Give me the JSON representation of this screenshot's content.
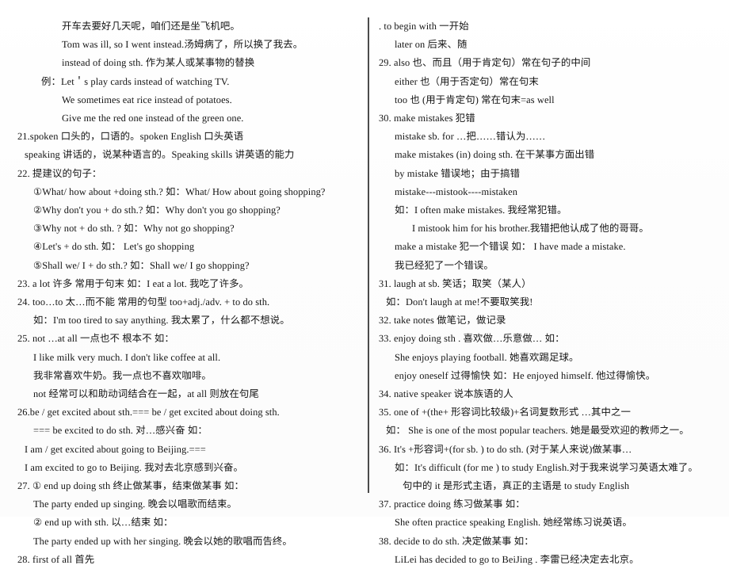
{
  "document": {
    "title": "English Grammar and Phrase Study Notes",
    "page_layout": "two-column",
    "divider": {
      "color": "#2b2b2b",
      "orientation": "vertical"
    }
  },
  "left_column": {
    "lines": [
      {
        "indent": 5,
        "text": "开车去要好几天呢，咱们还是坐飞机吧。"
      },
      {
        "indent": 5,
        "text": "Tom was ill, so I went instead.汤姆病了，所以换了我去。"
      },
      {
        "indent": 5,
        "text": "instead of doing sth.  作为某人或某事物的替换"
      },
      {
        "indent": 3,
        "text": "例：Let＇s play cards instead of watching TV."
      },
      {
        "indent": 5,
        "text": "We sometimes eat rice instead of potatoes."
      },
      {
        "indent": 5,
        "text": "Give me the red one instead of the green one."
      },
      {
        "indent": 0,
        "text": "21.spoken  口头的，口语的。spoken English   口头英语"
      },
      {
        "indent": 1,
        "text": "speaking  讲话的，说某种语言的。Speaking skills 讲英语的能力"
      },
      {
        "indent": 0,
        "text": "22. 提建议的句子："
      },
      {
        "indent": 2,
        "text": "①What/ how about +doing sth.?    如：What/ How about going shopping?"
      },
      {
        "indent": 2,
        "text": "②Why don't you + do sth.?  如：Why don't you go shopping?"
      },
      {
        "indent": 2,
        "text": "③Why not + do sth. ?            如：Why not go shopping?"
      },
      {
        "indent": 2,
        "text": "④Let's + do sth.                     如：   Let's go shopping"
      },
      {
        "indent": 2,
        "text": "⑤Shall we/ I + do sth.?          如：Shall we/ I go shopping?"
      },
      {
        "indent": 0,
        "text": "23. a lot  许多    常用于句末  如：I eat a lot. 我吃了许多。"
      },
      {
        "indent": 0,
        "text": "24. too…to  太…而不能    常用的句型  too+adj./adv. + to do sth."
      },
      {
        "indent": 2,
        "text": "如：I'm too tired to say anything. 我太累了，什么都不想说。"
      },
      {
        "indent": 0,
        "text": "25. not …at all  一点也不   根本不   如："
      },
      {
        "indent": 2,
        "text": "I like milk very much. I don't like coffee at all."
      },
      {
        "indent": 2,
        "text": "我非常喜欢牛奶。我一点也不喜欢咖啡。"
      },
      {
        "indent": 2,
        "text": "not 经常可以和助动词结合在一起，at all  则放在句尾"
      },
      {
        "indent": 0,
        "text": "26.be / get excited about sth.=== be / get excited about doing sth."
      },
      {
        "indent": 2,
        "text": "=== be excited to do sth.  对…感兴奋  如："
      },
      {
        "indent": 1,
        "text": "I am / get excited about going to Beijing.==="
      },
      {
        "indent": 1,
        "text": "I am excited to go to Beijing.  我对去北京感到兴奋。"
      },
      {
        "indent": 0,
        "text": "27. ①  end up doing sth       终止做某事，结束做某事   如："
      },
      {
        "indent": 2,
        "text": "The party ended up singing.  晚会以唱歌而结束。"
      },
      {
        "indent": 2,
        "text": "②  end up with sth.        以…结束  如："
      },
      {
        "indent": 2,
        "text": "The party ended up with her singing.  晚会以她的歌唱而告终。"
      },
      {
        "indent": 0,
        "text": "28. first of all  首先"
      }
    ]
  },
  "right_column": {
    "lines": [
      {
        "indent": 0,
        "text": ".    to begin with  一开始"
      },
      {
        "indent": 2,
        "text": "later on  后来、随"
      },
      {
        "indent": 0,
        "text": "29. also  也、而且（用于肯定句）常在句子的中间"
      },
      {
        "indent": 2,
        "text": "either  也（用于否定句）常在句末"
      },
      {
        "indent": 2,
        "text": "too    也 (用于肯定句)     常在句末=as well"
      },
      {
        "indent": 0,
        "text": "30. make mistakes  犯错"
      },
      {
        "indent": 2,
        "text": "mistake sb. for …把……错认为……"
      },
      {
        "indent": 2,
        "text": "make mistakes (in) doing sth. 在干某事方面出错"
      },
      {
        "indent": 2,
        "text": "by mistake  错误地；由于搞错"
      },
      {
        "indent": 2,
        "text": "mistake---mistook----mistaken"
      },
      {
        "indent": 2,
        "text": "如：I often make mistakes. 我经常犯错。"
      },
      {
        "indent": 4,
        "text": "I mistook him for his brother.我错把他认成了他的哥哥。"
      },
      {
        "indent": 2,
        "text": "make a mistake  犯一个错误  如：   I have made a mistake."
      },
      {
        "indent": 2,
        "text": "我已经犯了一个错误。"
      },
      {
        "indent": 0,
        "text": "31. laugh at sb.  笑话；取笑（某人）"
      },
      {
        "indent": 1,
        "text": "如：Don't laugh at me!不要取笑我!"
      },
      {
        "indent": 0,
        "text": "32. take notes  做笔记，做记录"
      },
      {
        "indent": 0,
        "text": "33. enjoy doing sth . 喜欢做…乐意做…  如："
      },
      {
        "indent": 2,
        "text": "She enjoys playing football.  她喜欢踢足球。"
      },
      {
        "indent": 2,
        "text": "enjoy oneself   过得愉快  如：He enjoyed himself.  他过得愉快。"
      },
      {
        "indent": 0,
        "text": "34. native speaker  说本族语的人"
      },
      {
        "indent": 0,
        "text": "35. one of +(the+  形容词比较级)+名词复数形式    …其中之一"
      },
      {
        "indent": 1,
        "text": "如：   She is one of the most popular teachers.  她是最受欢迎的教师之一。"
      },
      {
        "indent": 0,
        "text": "36. It's +形容词+(for sb. ) to do sth. (对于某人来说)做某事…"
      },
      {
        "indent": 2,
        "text": "如：It's difficult (for me ) to study English.对于我来说学习英语太难了。"
      },
      {
        "indent": 3,
        "text": "句中的 it  是形式主语，真正的主语是 to study English"
      },
      {
        "indent": 0,
        "text": "37. practice doing  练习做某事     如："
      },
      {
        "indent": 2,
        "text": "She often practice speaking English.  她经常练习说英语。"
      },
      {
        "indent": 0,
        "text": "38. decide to do sth.  决定做某事  如："
      },
      {
        "indent": 2,
        "text": "LiLei has decided to go to BeiJing .  李雷已经决定去北京。"
      }
    ]
  }
}
